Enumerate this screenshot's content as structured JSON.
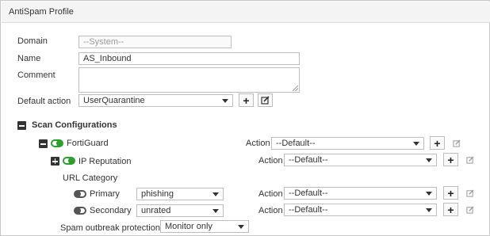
{
  "window": {
    "title": "AntiSpam Profile"
  },
  "form": {
    "domain": {
      "label": "Domain",
      "value": "--System--"
    },
    "name": {
      "label": "Name",
      "value": "AS_Inbound"
    },
    "comment": {
      "label": "Comment",
      "value": ""
    },
    "default_action": {
      "label": "Default action",
      "value": "UserQuarantine"
    }
  },
  "scan": {
    "heading": "Scan Configurations",
    "fortiguard": {
      "label": "FortiGuard",
      "enabled": true,
      "action_label": "Action",
      "action_value": "--Default--"
    },
    "ip_reputation": {
      "label": "IP Reputation",
      "enabled": true,
      "action_label": "Action",
      "action_value": "--Default--"
    },
    "url_category": {
      "heading": "URL Category",
      "primary": {
        "label": "Primary",
        "enabled": false,
        "category": "phishing",
        "action_label": "Action",
        "action_value": "--Default--"
      },
      "secondary": {
        "label": "Secondary",
        "enabled": false,
        "category": "unrated",
        "action_label": "Action",
        "action_value": "--Default--"
      }
    },
    "spam_outbreak": {
      "label": "Spam outbreak protection",
      "value": "Monitor only"
    }
  },
  "icons": {
    "add": "plus-icon",
    "edit": "edit-icon",
    "collapse": "minus-square-icon",
    "expand": "plus-square-icon"
  },
  "colors": {
    "toggle_on": "#2e9e2e",
    "toggle_off": "#555555",
    "border": "#bdbdbd"
  }
}
